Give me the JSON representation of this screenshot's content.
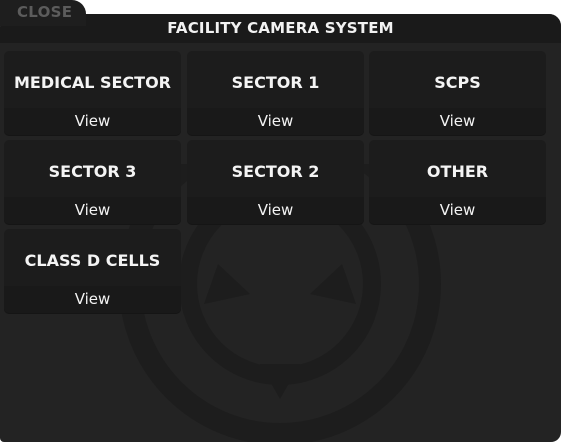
{
  "close_tab": {
    "label": "CLOSE"
  },
  "window": {
    "title": "FACILITY CAMERA SYSTEM"
  },
  "cameras": [
    {
      "name": "MEDICAL SECTOR",
      "action": "View"
    },
    {
      "name": "SECTOR 1",
      "action": "View"
    },
    {
      "name": "SCPS",
      "action": "View"
    },
    {
      "name": "SECTOR 3",
      "action": "View"
    },
    {
      "name": "SECTOR 2",
      "action": "View"
    },
    {
      "name": "OTHER",
      "action": "View"
    },
    {
      "name": "CLASS D CELLS",
      "action": "View"
    }
  ],
  "colors": {
    "panel_bg": "#232323",
    "header_bg": "#1a1a1a",
    "card_bg": "#1c1c1c",
    "text": "#f4f4f4",
    "close_text": "#5c5c5c"
  },
  "watermark_icon": "scp-foundation-logo-icon"
}
